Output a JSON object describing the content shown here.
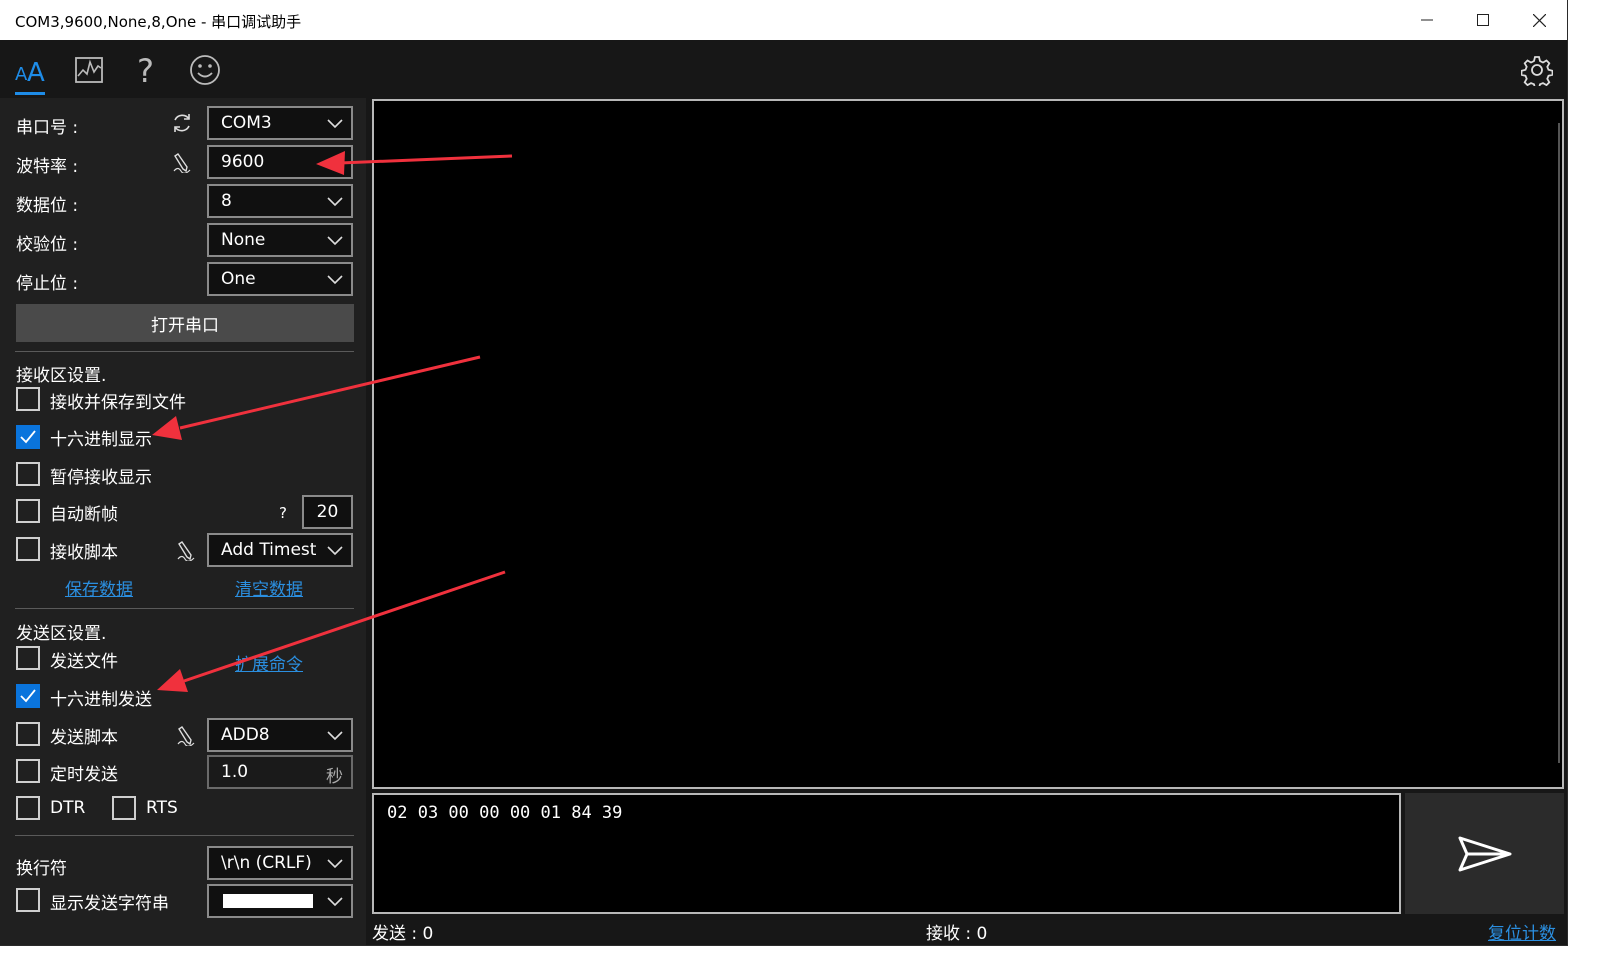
{
  "window": {
    "title": "COM3,9600,None,8,One - 串口调试助手",
    "minimize_glyph": "—",
    "maximize_glyph": "☐",
    "close_glyph": "✕"
  },
  "toolbar": {
    "tabs": [
      "text-mode-icon",
      "chart-icon",
      "help-icon",
      "smiley-icon"
    ],
    "settings": "gear-icon",
    "accent": "#1e8ce8"
  },
  "serial": {
    "port_label": "串口号 :",
    "port_value": "COM3",
    "baud_label": "波特率 :",
    "baud_value": "9600",
    "databits_label": "数据位 :",
    "databits_value": "8",
    "parity_label": "校验位 :",
    "parity_value": "None",
    "stopbits_label": "停止位 :",
    "stopbits_value": "One",
    "open_button": "打开串口"
  },
  "receive": {
    "section_title": "接收区设置.",
    "save_to_file": "接收并保存到文件",
    "hex_display": "十六进制显示",
    "pause_display": "暂停接收显示",
    "auto_frame": "自动断帧",
    "auto_frame_help": "?",
    "auto_frame_value": "20",
    "script": "接收脚本",
    "script_value": "Add Timestamp",
    "save_data_link": "保存数据",
    "clear_data_link": "清空数据"
  },
  "send": {
    "section_title": "发送区设置.",
    "send_file": "发送文件",
    "extend_cmd_link": "扩展命令",
    "hex_send": "十六进制发送",
    "script": "发送脚本",
    "script_value": "ADD8",
    "timed_send": "定时发送",
    "timed_value": "1.0",
    "timed_unit": "秒",
    "dtr": "DTR",
    "rts": "RTS",
    "newline_label": "换行符",
    "newline_value": "\\r\\n (CRLF)",
    "show_send_string": "显示发送字符串",
    "show_send_color": "#ffffff",
    "content": "02 03 00 00 00 01 84 39"
  },
  "checkboxes": {
    "save_to_file": false,
    "hex_display": true,
    "pause_display": false,
    "auto_frame": false,
    "recv_script": false,
    "send_file": false,
    "hex_send": true,
    "send_script": false,
    "timed_send": false,
    "dtr": false,
    "rts": false,
    "show_send_string": false
  },
  "status": {
    "sent": "发送 : 0",
    "received": "接收 : 0",
    "reset_link": "复位计数"
  },
  "annotation_color": "#f0313d"
}
